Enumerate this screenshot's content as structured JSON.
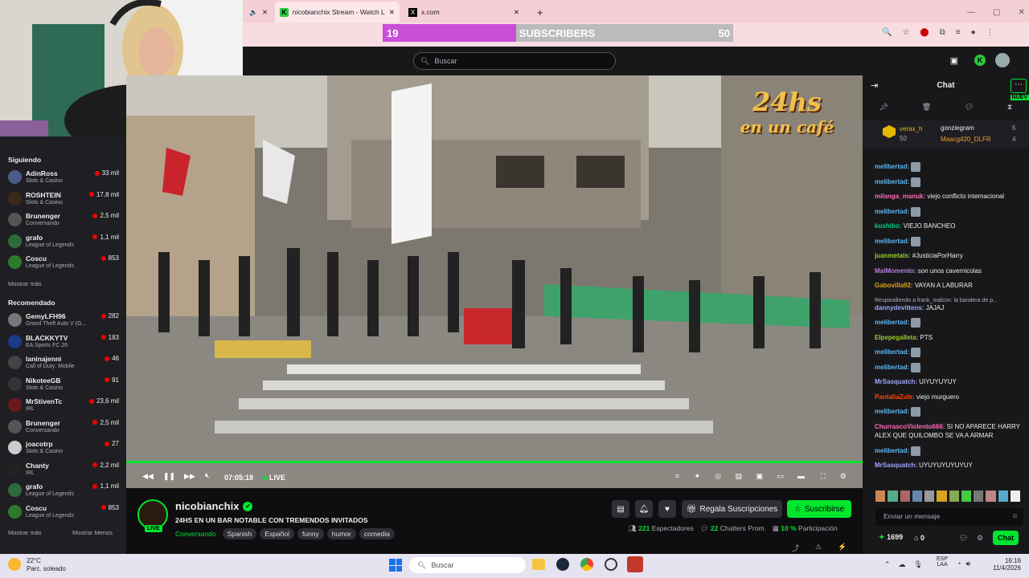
{
  "browser": {
    "tabs": [
      {
        "label": "nicobianchix Stream - Watch Li"
      },
      {
        "label": "x.com"
      }
    ],
    "new_tab": "+"
  },
  "subgoal": {
    "current": "19",
    "label": "SUBSCRIBERS",
    "goal": "50",
    "progress": 0.38
  },
  "topnav": {
    "search_placeholder": "Buscar"
  },
  "sidebar": {
    "following_title": "Siguiendo",
    "following": [
      {
        "name": "AdinRoss",
        "game": "Slots & Casino",
        "viewers": "33 mil",
        "color": "#4a5a8a"
      },
      {
        "name": "ROSHTEIN",
        "game": "Slots & Casino",
        "viewers": "17,8 mil",
        "color": "#3b2a1a"
      },
      {
        "name": "Brunenger",
        "game": "Conversando",
        "viewers": "2,5 mil",
        "color": "#555"
      },
      {
        "name": "grafo",
        "game": "League of Legends",
        "viewers": "1,1 mil",
        "color": "#2e6b3a"
      },
      {
        "name": "Coscu",
        "game": "League of Legends",
        "viewers": "853",
        "color": "#2d7a2d"
      }
    ],
    "show_more_1": "Mostrar más",
    "recommended_title": "Recomendado",
    "recommended": [
      {
        "name": "GemyLFH96",
        "game": "Grand Theft Auto V (G...",
        "viewers": "282",
        "color": "#777"
      },
      {
        "name": "BLACKKYTV",
        "game": "EA Sports FC 26",
        "viewers": "183",
        "color": "#1a3a8a"
      },
      {
        "name": "laninajenni",
        "game": "Call of Duty: Mobile",
        "viewers": "46",
        "color": "#444"
      },
      {
        "name": "NikoteeGB",
        "game": "Slots & Casino",
        "viewers": "91",
        "color": "#333"
      },
      {
        "name": "MrStivenTc",
        "game": "IRL",
        "viewers": "23,6 mil",
        "color": "#6a1a1a"
      },
      {
        "name": "Brunenger",
        "game": "Conversando",
        "viewers": "2,5 mil",
        "color": "#555"
      },
      {
        "name": "joacotrp",
        "game": "Slots & Casino",
        "viewers": "27",
        "color": "#ccc"
      },
      {
        "name": "Chanty",
        "game": "IRL",
        "viewers": "2,2 mil",
        "color": "#222"
      },
      {
        "name": "grafo",
        "game": "League of Legends",
        "viewers": "1,1 mil",
        "color": "#2e6b3a"
      },
      {
        "name": "Coscu",
        "game": "League of Legends",
        "viewers": "853",
        "color": "#2d7a2d"
      }
    ],
    "show_more_2": "Mostrar más",
    "show_less": "Mostrar Menos"
  },
  "player": {
    "time": "07:05:18",
    "live": "LIVE",
    "overlay_logo_line1": "24hs",
    "overlay_logo_line2": "en un café"
  },
  "stream": {
    "channel": "nicobianchix",
    "live_badge": "LIVE",
    "title": "24HS EN UN BAR NOTABLE CON TREMENDOS INVITADOS",
    "category": "Conversando",
    "tags": [
      "Spanish",
      "Español",
      "funny",
      "humor",
      "comedia"
    ],
    "gift_label": "Regala Suscripciones",
    "subscribe_label": "Suscribirse",
    "viewers": "221",
    "viewers_label": "Espectadores",
    "chatters": "22",
    "chatters_label": "Chatters Prom.",
    "participation": "10 %",
    "participation_label": "Participación"
  },
  "chat": {
    "title": "Chat",
    "new_badge": "NUEV",
    "leaders": [
      {
        "name": "verax_h",
        "count": "50"
      },
      {
        "name": "gonziegram",
        "count": "5"
      },
      {
        "name": "Maacg420_DLFR",
        "count": "4"
      }
    ],
    "messages": [
      {
        "user": "melibertad:",
        "text": "",
        "color": "#5fb7f0"
      },
      {
        "user": "melibertad:",
        "text": "",
        "color": "#5fb7f0"
      },
      {
        "user": "milanga_manuk:",
        "text": "viejo conflicto internacional",
        "color": "#ff69b4"
      },
      {
        "user": "melibertad:",
        "text": "",
        "color": "#5fb7f0"
      },
      {
        "user": "kushibo:",
        "text": "VIEJO BANCHEO",
        "color": "#00d084"
      },
      {
        "user": "melibertad:",
        "text": "",
        "color": "#5fb7f0"
      },
      {
        "user": "juanmetals:",
        "text": "#JusticiaPorHarry",
        "color": "#9acd32"
      },
      {
        "user": "MalMomento:",
        "text": "son unos cavernicolas",
        "color": "#b57edc"
      },
      {
        "user": "Gabovilla92:",
        "text": "VAYAN A LABURAR",
        "color": "#daa520"
      },
      {
        "user": "dannydevittens:",
        "text": "JAJAJ",
        "color": "#9ea7ff",
        "reply": "Respondiendo a frank_malcov: la bandera de p..."
      },
      {
        "user": "melibertad:",
        "text": "",
        "color": "#5fb7f0"
      },
      {
        "user": "Elpepegalleta:",
        "text": "PTS",
        "color": "#9acd32"
      },
      {
        "user": "melibertad:",
        "text": "",
        "color": "#5fb7f0"
      },
      {
        "user": "melibertad:",
        "text": "",
        "color": "#5fb7f0"
      },
      {
        "user": "MrSasquatch:",
        "text": "UIYUYUYUY",
        "color": "#9ea7ff"
      },
      {
        "user": "PantaliaZule:",
        "text": "viejo murguero",
        "color": "#ff4500"
      },
      {
        "user": "melibertad:",
        "text": "",
        "color": "#5fb7f0"
      },
      {
        "user": "ChurrascoViolento666:",
        "text": "SI NO APARECE HARRY ALEX QUE QUILOMBO SE VA A ARMAR",
        "color": "#ff69b4"
      },
      {
        "user": "melibertad:",
        "text": "",
        "color": "#5fb7f0"
      },
      {
        "user": "MrSasquatch:",
        "text": "UYUYUYUYUYUY",
        "color": "#9ea7ff"
      }
    ],
    "input_placeholder": "Enviar un mensaje",
    "points": "1699",
    "bits": "0",
    "chat_button": "Chat"
  },
  "taskbar": {
    "weather_temp": "22°C",
    "weather_desc": "Parc. soleado",
    "search_placeholder": "Buscar",
    "lang": "ESP",
    "lang2": "LAA",
    "time": "16:16",
    "date": "11/4/2026"
  }
}
